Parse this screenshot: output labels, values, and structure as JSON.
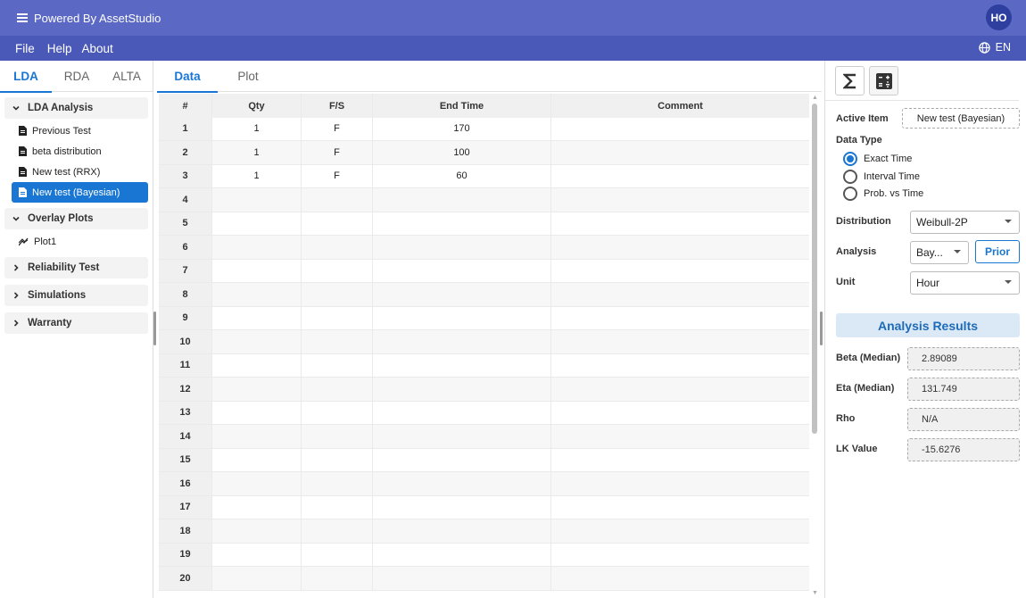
{
  "app": {
    "title": "Powered By AssetStudio",
    "avatar": "HO"
  },
  "menu": {
    "items": [
      "File",
      "Help",
      "About"
    ],
    "lang": "EN"
  },
  "left": {
    "tabs": [
      "LDA",
      "RDA",
      "ALTA"
    ],
    "tree": {
      "g1": "LDA Analysis",
      "items": [
        "Previous Test",
        "beta distribution",
        "New test (RRX)",
        "New test (Bayesian)"
      ],
      "g2": "Overlay Plots",
      "plot": "Plot1",
      "g3": "Reliability Test",
      "g4": "Simulations",
      "g5": "Warranty"
    }
  },
  "center": {
    "tabs": [
      "Data",
      "Plot"
    ],
    "columns": [
      "#",
      "Qty",
      "F/S",
      "End Time",
      "Comment"
    ],
    "rows": [
      [
        "1",
        "1",
        "F",
        "170",
        ""
      ],
      [
        "2",
        "1",
        "F",
        "100",
        ""
      ],
      [
        "3",
        "1",
        "F",
        "60",
        ""
      ],
      [
        "4",
        "",
        "",
        "",
        ""
      ],
      [
        "5",
        "",
        "",
        "",
        ""
      ],
      [
        "6",
        "",
        "",
        "",
        ""
      ],
      [
        "7",
        "",
        "",
        "",
        ""
      ],
      [
        "8",
        "",
        "",
        "",
        ""
      ],
      [
        "9",
        "",
        "",
        "",
        ""
      ],
      [
        "10",
        "",
        "",
        "",
        ""
      ],
      [
        "11",
        "",
        "",
        "",
        ""
      ],
      [
        "12",
        "",
        "",
        "",
        ""
      ],
      [
        "13",
        "",
        "",
        "",
        ""
      ],
      [
        "14",
        "",
        "",
        "",
        ""
      ],
      [
        "15",
        "",
        "",
        "",
        ""
      ],
      [
        "16",
        "",
        "",
        "",
        ""
      ],
      [
        "17",
        "",
        "",
        "",
        ""
      ],
      [
        "18",
        "",
        "",
        "",
        ""
      ],
      [
        "19",
        "",
        "",
        "",
        ""
      ],
      [
        "20",
        "",
        "",
        "",
        ""
      ]
    ]
  },
  "right": {
    "active_item_label": "Active Item",
    "active_item": "New test (Bayesian)",
    "data_type_label": "Data Type",
    "data_types": [
      "Exact Time",
      "Interval Time",
      "Prob. vs Time"
    ],
    "distribution_label": "Distribution",
    "distribution": "Weibull-2P",
    "analysis_label": "Analysis",
    "analysis": "Bay...",
    "prior": "Prior",
    "unit_label": "Unit",
    "unit": "Hour",
    "results_title": "Analysis Results",
    "beta_label": "Beta (Median)",
    "beta": "2.89089",
    "eta_label": "Eta (Median)",
    "eta": "131.749",
    "rho_label": "Rho",
    "rho": "N/A",
    "lk_label": "LK Value",
    "lk": "-15.6276"
  },
  "colors": {
    "header": "#5b68c4",
    "menubar": "#4a58b8",
    "accent": "#1976d2"
  }
}
